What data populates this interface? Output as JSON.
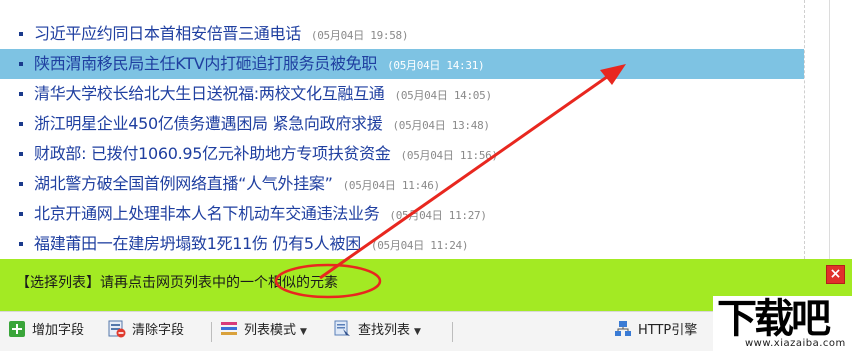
{
  "news": [
    {
      "title": "习近平应约同日本首相安倍晋三通电话",
      "time": "(05月04日 19:58)",
      "selected": false
    },
    {
      "title": "陕西渭南移民局主任KTV内打砸追打服务员被免职",
      "time": "(05月04日 14:31)",
      "selected": true
    },
    {
      "title": "清华大学校长给北大生日送祝福:两校文化互融互通",
      "time": "(05月04日 14:05)",
      "selected": false
    },
    {
      "title": "浙江明星企业450亿债务遭遇困局 紧急向政府求援",
      "time": "(05月04日 13:48)",
      "selected": false
    },
    {
      "title": "财政部: 已拨付1060.95亿元补助地方专项扶贫资金",
      "time": "(05月04日 11:56)",
      "selected": false
    },
    {
      "title": "湖北警方破全国首例网络直播“人气外挂案”",
      "time": "(05月04日 11:46)",
      "selected": false
    },
    {
      "title": "北京开通网上处理非本人名下机动车交通违法业务",
      "time": "(05月04日 11:27)",
      "selected": false
    },
    {
      "title": "福建莆田一在建房坍塌致1死11伤 仍有5人被困",
      "time": "(05月04日 11:24)",
      "selected": false
    }
  ],
  "hint": {
    "text": "【选择列表】请再点击网页列表中的一个相似的元素",
    "close_label": "×"
  },
  "toolbar": {
    "add_field": "增加字段",
    "clear_field": "清除字段",
    "list_mode": "列表模式",
    "find_list": "查找列表",
    "http_engine": "HTTP引擎"
  },
  "logo": {
    "mark": "下载吧",
    "url": "www.xiazaiba.com"
  },
  "colors": {
    "selected_row": "#7ec3e3",
    "hint_bar": "#a3ea23",
    "annotation": "#e8271f",
    "link": "#1f3fa0"
  }
}
